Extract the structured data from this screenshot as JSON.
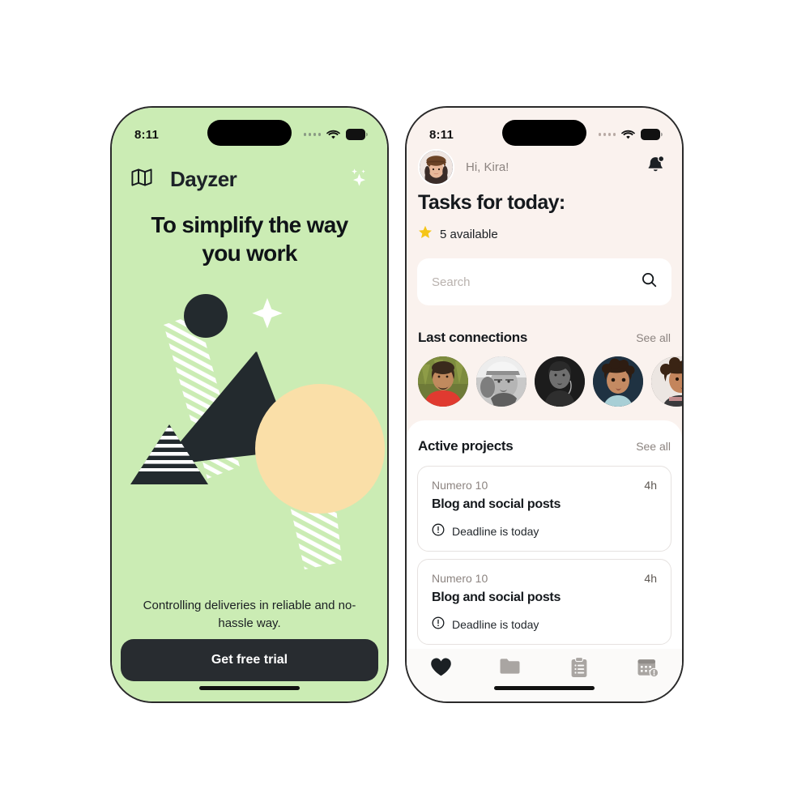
{
  "meta": {
    "green_bg": "#CBECB4",
    "cream_bg": "#FAF2EE",
    "dark": "#282C30",
    "star_yellow": "#F5C518",
    "sand": "#FADFA8"
  },
  "left_phone": {
    "status": {
      "time": "8:11",
      "signal_icon": "signal-dots-icon",
      "wifi_icon": "wifi-icon",
      "battery_icon": "battery-icon"
    },
    "header": {
      "menu_icon": "map-icon",
      "brand": "Dayzer",
      "sparkle_icon": "sparkles-icon"
    },
    "headline": "To simplify the way you work",
    "illustration": "abstract-geometric-illustration",
    "subtext": "Controlling deliveries in reliable and no-hassle way.",
    "cta_label": "Get free trial"
  },
  "right_phone": {
    "status": {
      "time": "8:11",
      "signal_icon": "signal-dots-icon",
      "wifi_icon": "wifi-icon",
      "battery_icon": "battery-icon"
    },
    "greeting": "Hi, Kira!",
    "avatar_icon": "user-avatar",
    "bell_icon": "bell-notification-icon",
    "title": "Tasks for today:",
    "available": {
      "star_icon": "star-icon",
      "label": "5 available"
    },
    "search": {
      "value": "",
      "placeholder": "Search",
      "icon": "search-icon"
    },
    "connections": {
      "title": "Last connections",
      "see_all": "See all",
      "avatars": [
        {
          "name": "connection-avatar-1"
        },
        {
          "name": "connection-avatar-2"
        },
        {
          "name": "connection-avatar-3"
        },
        {
          "name": "connection-avatar-4"
        },
        {
          "name": "connection-avatar-5"
        }
      ]
    },
    "projects": {
      "title": "Active projects",
      "see_all": "See all",
      "cards": [
        {
          "client": "Numero 10",
          "hours": "4h",
          "title": "Blog and social posts",
          "deadline": "Deadline is today",
          "deadline_icon": "exclamation-circle-icon"
        },
        {
          "client": "Numero 10",
          "hours": "4h",
          "title": "Blog and social posts",
          "deadline": "Deadline is today",
          "deadline_icon": "exclamation-circle-icon"
        }
      ]
    },
    "tabbar": [
      {
        "name": "tab-favorites",
        "icon": "heart-icon",
        "active": true
      },
      {
        "name": "tab-files",
        "icon": "folder-icon",
        "active": false
      },
      {
        "name": "tab-tasks",
        "icon": "clipboard-icon",
        "active": false
      },
      {
        "name": "tab-calendar",
        "icon": "calendar-alert-icon",
        "active": false
      }
    ]
  }
}
